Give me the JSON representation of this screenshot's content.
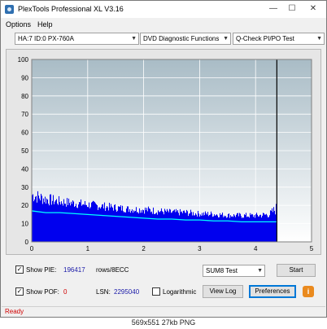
{
  "window": {
    "title": "PlexTools Professional XL V3.16",
    "controls": {
      "minimize": "—",
      "maximize": "☐",
      "close": "✕"
    }
  },
  "menu": {
    "options": "Options",
    "help": "Help"
  },
  "toolbar": {
    "device": "HA:7 ID:0  PX-760A",
    "function": "DVD Diagnostic Functions",
    "test": "Q-Check PI/PO Test"
  },
  "chart_data": {
    "type": "area",
    "xlim": [
      0,
      5
    ],
    "ylim": [
      0,
      100
    ],
    "x_ticks": [
      "0",
      "1",
      "2",
      "3",
      "4",
      "5"
    ],
    "y_ticks": [
      "0",
      "10",
      "20",
      "30",
      "40",
      "50",
      "60",
      "70",
      "80",
      "90",
      "100"
    ],
    "end_marker_x": 4.38,
    "grid": true,
    "colors": {
      "pi": "#0000ee",
      "avg": "#00ffff",
      "marker": "#000000",
      "background_top": "#a9bcc6",
      "background_bottom": "#ffffff"
    },
    "series": [
      {
        "x": [
          0.0,
          0.25,
          0.5,
          0.75,
          1.0,
          1.25,
          1.5,
          1.75,
          2.0,
          2.25,
          2.5,
          2.75,
          3.0,
          3.25,
          3.5,
          3.75,
          4.0,
          4.25,
          4.38
        ],
        "values": [
          30,
          27,
          25,
          24,
          23,
          22,
          21,
          20,
          20,
          19,
          18,
          18,
          17,
          17,
          16,
          16,
          16,
          17,
          22
        ]
      },
      {
        "x": [
          0.0,
          0.25,
          0.5,
          0.75,
          1.0,
          1.25,
          1.5,
          1.75,
          2.0,
          2.25,
          2.5,
          2.75,
          3.0,
          3.25,
          3.5,
          3.75,
          4.0,
          4.25,
          4.38
        ],
        "values": [
          17,
          16,
          16,
          15.5,
          15,
          14.5,
          14,
          13.5,
          13,
          12.5,
          12.5,
          12,
          12,
          11.5,
          11.5,
          11,
          11,
          11,
          11
        ]
      }
    ]
  },
  "stats": {
    "show_pie_label": "Show PIE:",
    "pie_value": "196417",
    "pie_unit": "rows/8ECC",
    "show_pof_label": "Show POF:",
    "pof_value": "0",
    "lsn_label": "LSN:",
    "lsn_value": "2295040",
    "logarithmic_label": "Logarithmic"
  },
  "buttons": {
    "sum_select": "SUM8 Test",
    "start": "Start",
    "view_log": "View Log",
    "preferences": "Preferences",
    "info": "i"
  },
  "status": {
    "text": "Ready"
  },
  "caption": "569x551  27kb PNG"
}
